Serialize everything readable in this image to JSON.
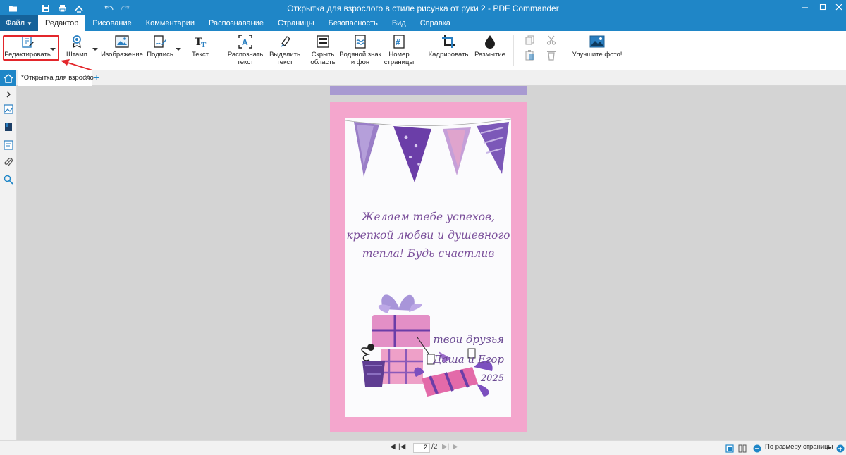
{
  "window": {
    "title": "Открытка для взрослого в стиле рисунка от руки 2 - PDF Commander",
    "controls": [
      "minimize-icon",
      "maximize-icon",
      "close-icon"
    ]
  },
  "quick_access": [
    "open-folder-icon",
    "save-icon",
    "print-icon",
    "share-icon",
    "undo-icon",
    "redo-icon"
  ],
  "menu": {
    "file_label": "Файл",
    "tabs": [
      {
        "label": "Редактор",
        "active": true
      },
      {
        "label": "Рисование",
        "active": false
      },
      {
        "label": "Комментарии",
        "active": false
      },
      {
        "label": "Распознавание",
        "active": false
      },
      {
        "label": "Страницы",
        "active": false
      },
      {
        "label": "Безопасность",
        "active": false
      },
      {
        "label": "Вид",
        "active": false
      },
      {
        "label": "Справка",
        "active": false
      }
    ]
  },
  "ribbon": {
    "edit": "Редактировать",
    "stamp": "Штамп",
    "image": "Изображение",
    "signature": "Подпись",
    "text": "Текст",
    "recognize_1": "Распознать",
    "recognize_2": "текст",
    "select_1": "Выделить",
    "select_2": "текст",
    "hide_1": "Скрыть",
    "hide_2": "область",
    "watermark_1": "Водяной знак",
    "watermark_2": "и фон",
    "pagenum_1": "Номер",
    "pagenum_2": "страницы",
    "crop": "Кадрировать",
    "blur": "Размытие",
    "enhance": "Улучшите фото!"
  },
  "document": {
    "tab_title": "*Открытка для взросло",
    "card": {
      "wish_1": "Желаем тебе успехов,",
      "wish_2": "крепкой любви и душевного",
      "wish_3": "тепла! Будь счастлив",
      "sig_1": "твои друзья",
      "sig_2": "Даша и Егор",
      "year": "2025"
    }
  },
  "colors": {
    "accent": "#1f86c7",
    "page_border": "#f4a6cd",
    "highlight": "#e3262b",
    "text_purple": "#7a4e9a"
  },
  "statusbar": {
    "current_page": "2",
    "total_pages": "/2",
    "zoom": "По размеру страницы"
  }
}
